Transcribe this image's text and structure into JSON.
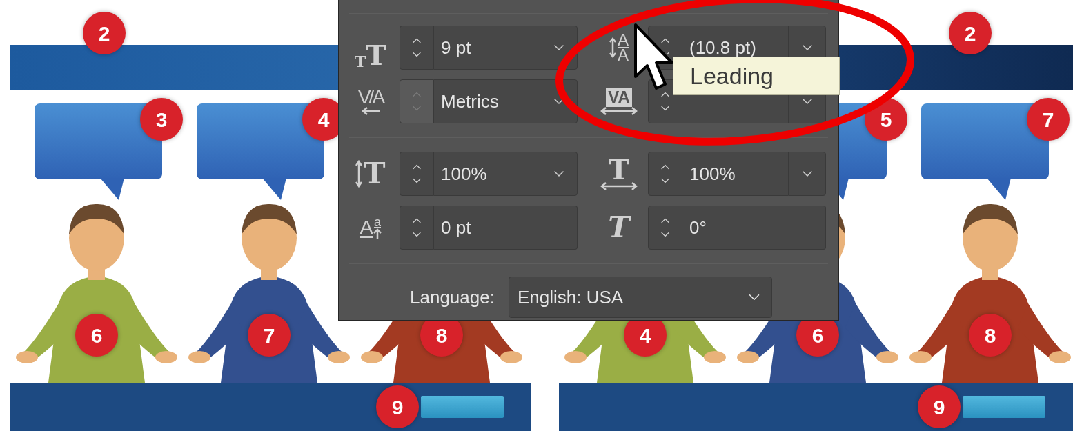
{
  "slides": [
    {
      "header_badge": "2",
      "bubbles": [
        {
          "badge": "3"
        },
        {
          "badge": "4"
        }
      ],
      "figures": [
        {
          "badge": "6",
          "color": "#9aae45"
        },
        {
          "badge": "7",
          "color": "#33508f"
        },
        {
          "badge": "8",
          "color": "#a33a22"
        }
      ],
      "footer_badge": "9"
    },
    {
      "header_badge": "2",
      "bubbles": [
        {
          "badge": "5"
        },
        {
          "badge": "7"
        }
      ],
      "figures": [
        {
          "badge": "4",
          "color": "#9aae45"
        },
        {
          "badge": "6",
          "color": "#33508f"
        },
        {
          "badge": "8",
          "color": "#a33a22"
        }
      ],
      "footer_badge": "9"
    }
  ],
  "character_panel": {
    "fields": [
      {
        "kind": "font-size",
        "glyphs": [
          "T",
          "T"
        ],
        "value": "9 pt",
        "dropdown": true,
        "disabled": false
      },
      {
        "kind": "leading",
        "glyphs": [
          "A",
          "A"
        ],
        "value": "(10.8 pt)",
        "dropdown": true,
        "disabled": false
      },
      {
        "kind": "kerning",
        "glyphs": [
          "V/A"
        ],
        "value": "Metrics",
        "dropdown": true,
        "disabled": true
      },
      {
        "kind": "tracking",
        "glyphs": [
          "VA"
        ],
        "dropdown": true,
        "disabled": false
      },
      {
        "kind": "vertical-scale",
        "glyphs": [
          "T"
        ],
        "value": "100%",
        "dropdown": true,
        "disabled": false
      },
      {
        "kind": "horizontal-scale",
        "glyphs": [
          "T"
        ],
        "value": "100%",
        "dropdown": true,
        "disabled": false
      },
      {
        "kind": "baseline-shift",
        "glyphs": [
          "A",
          "a"
        ],
        "value": "0 pt",
        "dropdown": false,
        "disabled": false
      },
      {
        "kind": "skew",
        "glyphs": [
          "T"
        ],
        "value": "0°",
        "dropdown": false,
        "disabled": false
      }
    ],
    "language": {
      "label": "Language:",
      "value": "English: USA"
    }
  },
  "tooltip": "Leading"
}
